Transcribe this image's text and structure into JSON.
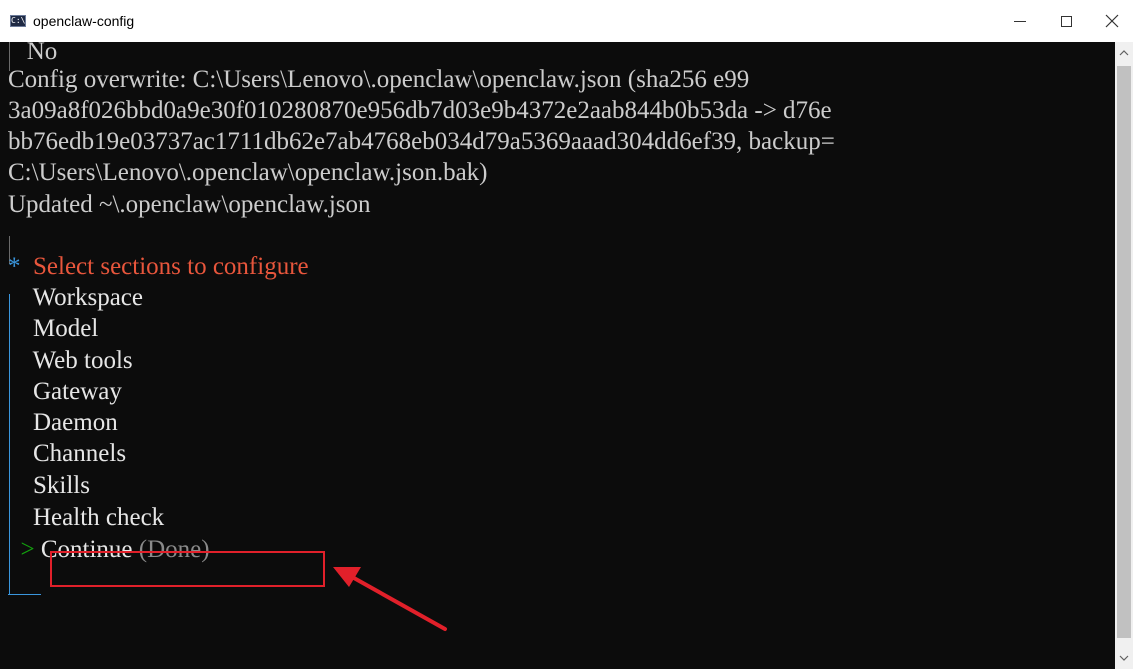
{
  "window": {
    "title": "openclaw-config",
    "icon_text": "C:\\"
  },
  "terminal": {
    "prev_answer": "No",
    "config_line_1": "Config overwrite: C:\\Users\\Lenovo\\.openclaw\\openclaw.json (sha256 e99",
    "config_line_2": "3a09a8f026bbd0a9e30f010280870e956db7d03e9b4372e2aab844b0b53da -> d76e",
    "config_line_3": "bb76edb19e03737ac1711db62e7ab4768eb034d79a5369aaad304dd6ef39, backup=",
    "config_line_4": "C:\\Users\\Lenovo\\.openclaw\\openclaw.json.bak)",
    "updated_line": "Updated ~\\.openclaw\\openclaw.json",
    "prompt_marker": "*",
    "prompt_title": "Select sections to configure",
    "options": [
      "Workspace",
      "Model",
      "Web tools",
      "Gateway",
      "Daemon",
      "Channels",
      "Skills",
      "Health check"
    ],
    "selected_pointer": ">",
    "selected_option": "Continue",
    "selected_hint": "(Done)"
  },
  "colors": {
    "prompt": "#e8563c",
    "highlight_annotation": "#e1202a",
    "pointer": "#13a10e",
    "rail_active": "#3a96dd"
  }
}
